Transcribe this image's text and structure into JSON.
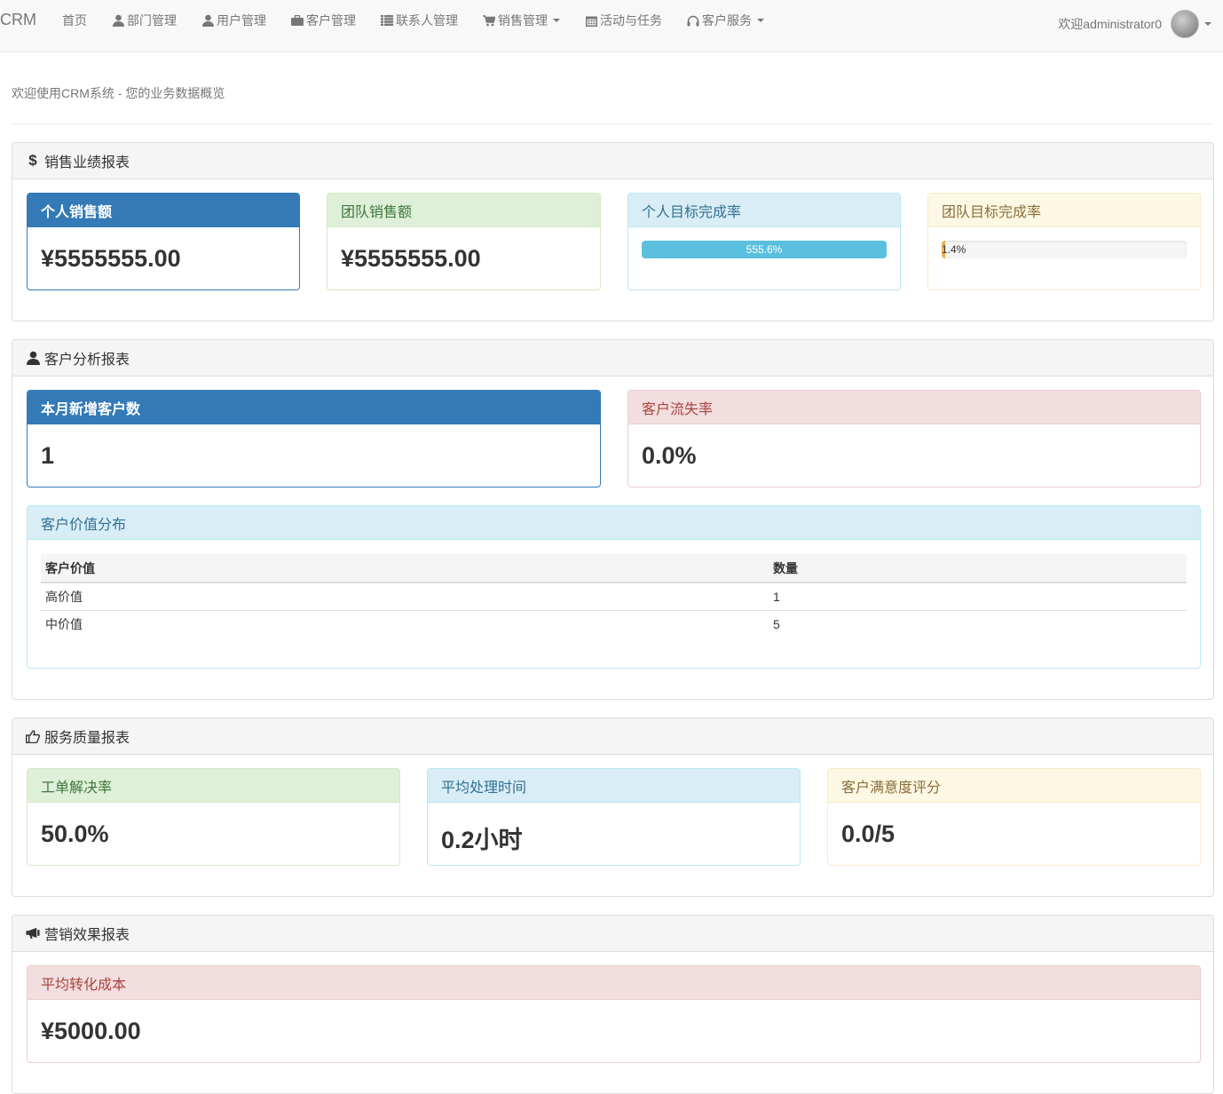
{
  "navbar": {
    "brand": "CRM",
    "items": [
      {
        "label": "首页",
        "icon": "",
        "caret": false
      },
      {
        "label": "部门管理",
        "icon": "user-icon",
        "caret": false
      },
      {
        "label": "用户管理",
        "icon": "user-icon",
        "caret": false
      },
      {
        "label": "客户管理",
        "icon": "briefcase-icon",
        "caret": false
      },
      {
        "label": "联系人管理",
        "icon": "list-icon",
        "caret": false
      },
      {
        "label": "销售管理",
        "icon": "cart-icon",
        "caret": true
      },
      {
        "label": "活动与任务",
        "icon": "calendar-icon",
        "caret": false
      },
      {
        "label": "客户服务",
        "icon": "headphones-icon",
        "caret": true
      }
    ],
    "welcome": "欢迎administrator0"
  },
  "page": {
    "subtitle": "欢迎使用CRM系统 - 您的业务数据概览"
  },
  "sales": {
    "title": "销售业绩报表",
    "personal_sales": {
      "label": "个人销售额",
      "value": "¥5555555.00"
    },
    "team_sales": {
      "label": "团队销售额",
      "value": "¥5555555.00"
    },
    "personal_target": {
      "label": "个人目标完成率",
      "value": "555.6%",
      "fill_percent": 100
    },
    "team_target": {
      "label": "团队目标完成率",
      "value": "1.4%",
      "fill_percent": 1.4
    }
  },
  "customers": {
    "title": "客户分析报表",
    "new_customers": {
      "label": "本月新增客户数",
      "value": "1"
    },
    "churn_rate": {
      "label": "客户流失率",
      "value": "0.0%"
    },
    "value_distribution": {
      "label": "客户价值分布",
      "headers": [
        "客户价值",
        "数量"
      ],
      "rows": [
        [
          "高价值",
          "1"
        ],
        [
          "中价值",
          "5"
        ]
      ]
    }
  },
  "service": {
    "title": "服务质量报表",
    "resolution_rate": {
      "label": "工单解决率",
      "value": "50.0%"
    },
    "avg_time": {
      "label": "平均处理时间",
      "value": "0.2小时"
    },
    "satisfaction": {
      "label": "客户满意度评分",
      "value": "0.0/5"
    }
  },
  "marketing": {
    "title": "营销效果报表",
    "conversion_cost": {
      "label": "平均转化成本",
      "value": "¥5000.00"
    }
  },
  "colors": {
    "primary": "#337ab7",
    "success_bg": "#dff0d8",
    "info_bg": "#d9edf7",
    "warning_bg": "#fcf8e3",
    "danger_bg": "#f2dede",
    "progress_info": "#5bc0de",
    "progress_warning": "#f0ad4e"
  }
}
